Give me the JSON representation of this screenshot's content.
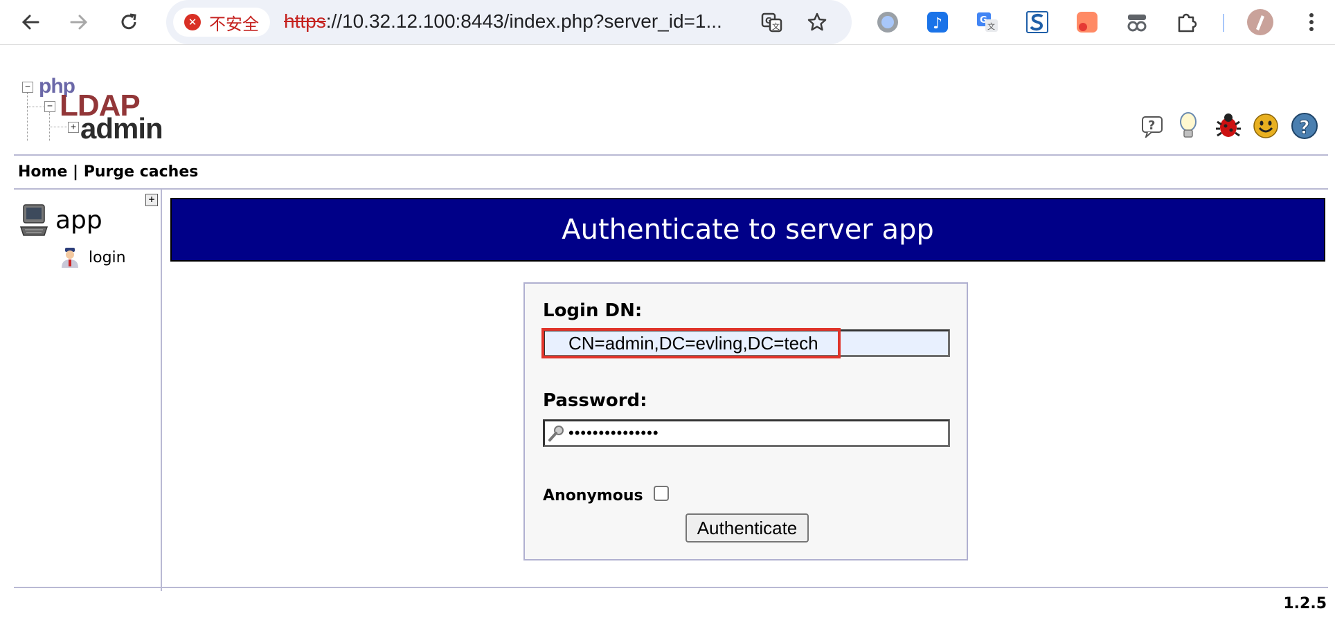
{
  "browser": {
    "security_label": "不安全",
    "url_scheme": "https",
    "url_rest": "://10.32.12.100:8443/index.php?server_id=1...",
    "icons": [
      "back-arrow-icon",
      "forward-arrow-icon",
      "reload-icon",
      "translate-icon",
      "bookmark-star-icon",
      "extension-icons",
      "puzzle-icon",
      "profile-avatar-icon",
      "menu-kebab-icon"
    ]
  },
  "header": {
    "logo_text": {
      "php": "php",
      "ldap": "LDAP",
      "admin": "admin"
    },
    "icons": [
      "help-icon",
      "tip-lightbulb-icon",
      "bug-icon",
      "smiley-icon",
      "question-icon"
    ]
  },
  "nav": {
    "home": "Home",
    "separator": "|",
    "purge": "Purge caches"
  },
  "tree": {
    "expand": "+",
    "server": "app",
    "login": "login"
  },
  "main": {
    "title": "Authenticate to server app",
    "login_dn_label": "Login DN:",
    "login_dn_value": "CN=admin,DC=evling,DC=tech",
    "password_label": "Password:",
    "password_value": "•••••••••••••••",
    "anonymous_label": "Anonymous",
    "anonymous_checked": false,
    "submit_label": "Authenticate"
  },
  "footer": {
    "version": "1.2.5"
  },
  "colors": {
    "banner": "#000088",
    "highlight": "#e0342a",
    "rule": "#b9b9d3"
  }
}
